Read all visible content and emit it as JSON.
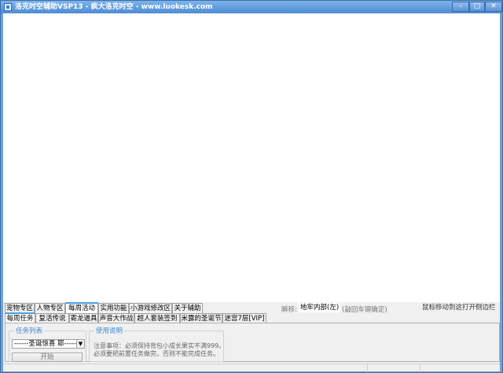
{
  "window": {
    "title": "洛克时空辅助VSP13 - 疯大洛克时空 - www.luokesk.com",
    "minimize": "–",
    "maximize": "□",
    "close": "✕"
  },
  "main_tabs": [
    {
      "label": "宠物专区"
    },
    {
      "label": "人物专区"
    },
    {
      "label": "每周活动",
      "selected": true
    },
    {
      "label": "实用功能"
    },
    {
      "label": "小游戏修改区"
    },
    {
      "label": "关于辅助"
    }
  ],
  "sub_tabs": [
    {
      "label": "每周任务",
      "selected": true
    },
    {
      "label": "复活传说"
    },
    {
      "label": "寄龙道具"
    },
    {
      "label": "声音大作战"
    },
    {
      "label": "超人套装签到"
    },
    {
      "label": "米露的圣诞节"
    },
    {
      "label": "迷宫7层[VIP]"
    }
  ],
  "teleport": {
    "label": "瞬移:",
    "value": "地牢内部(左)",
    "hint": "(敲回车键确定)"
  },
  "sidebar_hint": "鼠标移动到这打开侧边栏",
  "task_group": {
    "title": "任务列表",
    "selected": "------圣诞惊喜 耶-----",
    "start": "开始"
  },
  "usage_group": {
    "title": "使用说明",
    "line1": "注意事项：必须保持背包小成长果实不满999。",
    "line2": "必须要把前置任务做完，否则不能完成任务。"
  }
}
